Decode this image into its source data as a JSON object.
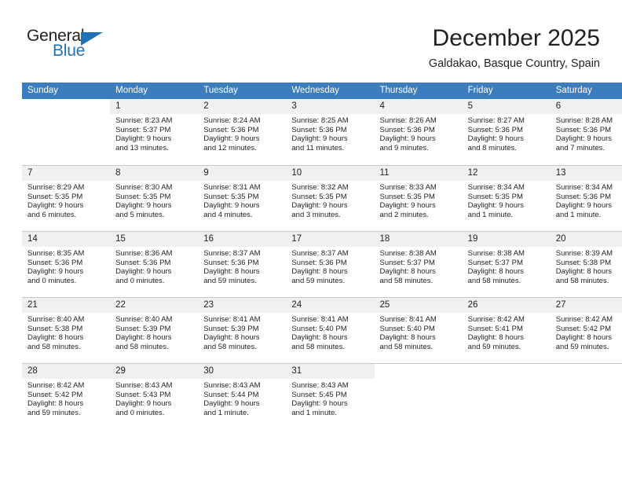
{
  "brand": {
    "name_part1": "General",
    "name_part2": "Blue",
    "triangle_color": "#1f72b8"
  },
  "header": {
    "title": "December 2025",
    "location": "Galdakao, Basque Country, Spain"
  },
  "theme": {
    "header_row_bg": "#3b7dbd",
    "header_row_text": "#ffffff",
    "daynum_bg": "#f0f0f0",
    "grid_line": "#c8c8c8",
    "text": "#231f20"
  },
  "weekdays": [
    "Sunday",
    "Monday",
    "Tuesday",
    "Wednesday",
    "Thursday",
    "Friday",
    "Saturday"
  ],
  "weeks": [
    [
      {
        "day": "",
        "sunrise": "",
        "sunset": "",
        "daylight_line1": "",
        "daylight_line2": ""
      },
      {
        "day": "1",
        "sunrise": "Sunrise: 8:23 AM",
        "sunset": "Sunset: 5:37 PM",
        "daylight_line1": "Daylight: 9 hours",
        "daylight_line2": "and 13 minutes."
      },
      {
        "day": "2",
        "sunrise": "Sunrise: 8:24 AM",
        "sunset": "Sunset: 5:36 PM",
        "daylight_line1": "Daylight: 9 hours",
        "daylight_line2": "and 12 minutes."
      },
      {
        "day": "3",
        "sunrise": "Sunrise: 8:25 AM",
        "sunset": "Sunset: 5:36 PM",
        "daylight_line1": "Daylight: 9 hours",
        "daylight_line2": "and 11 minutes."
      },
      {
        "day": "4",
        "sunrise": "Sunrise: 8:26 AM",
        "sunset": "Sunset: 5:36 PM",
        "daylight_line1": "Daylight: 9 hours",
        "daylight_line2": "and 9 minutes."
      },
      {
        "day": "5",
        "sunrise": "Sunrise: 8:27 AM",
        "sunset": "Sunset: 5:36 PM",
        "daylight_line1": "Daylight: 9 hours",
        "daylight_line2": "and 8 minutes."
      },
      {
        "day": "6",
        "sunrise": "Sunrise: 8:28 AM",
        "sunset": "Sunset: 5:36 PM",
        "daylight_line1": "Daylight: 9 hours",
        "daylight_line2": "and 7 minutes."
      }
    ],
    [
      {
        "day": "7",
        "sunrise": "Sunrise: 8:29 AM",
        "sunset": "Sunset: 5:35 PM",
        "daylight_line1": "Daylight: 9 hours",
        "daylight_line2": "and 6 minutes."
      },
      {
        "day": "8",
        "sunrise": "Sunrise: 8:30 AM",
        "sunset": "Sunset: 5:35 PM",
        "daylight_line1": "Daylight: 9 hours",
        "daylight_line2": "and 5 minutes."
      },
      {
        "day": "9",
        "sunrise": "Sunrise: 8:31 AM",
        "sunset": "Sunset: 5:35 PM",
        "daylight_line1": "Daylight: 9 hours",
        "daylight_line2": "and 4 minutes."
      },
      {
        "day": "10",
        "sunrise": "Sunrise: 8:32 AM",
        "sunset": "Sunset: 5:35 PM",
        "daylight_line1": "Daylight: 9 hours",
        "daylight_line2": "and 3 minutes."
      },
      {
        "day": "11",
        "sunrise": "Sunrise: 8:33 AM",
        "sunset": "Sunset: 5:35 PM",
        "daylight_line1": "Daylight: 9 hours",
        "daylight_line2": "and 2 minutes."
      },
      {
        "day": "12",
        "sunrise": "Sunrise: 8:34 AM",
        "sunset": "Sunset: 5:35 PM",
        "daylight_line1": "Daylight: 9 hours",
        "daylight_line2": "and 1 minute."
      },
      {
        "day": "13",
        "sunrise": "Sunrise: 8:34 AM",
        "sunset": "Sunset: 5:36 PM",
        "daylight_line1": "Daylight: 9 hours",
        "daylight_line2": "and 1 minute."
      }
    ],
    [
      {
        "day": "14",
        "sunrise": "Sunrise: 8:35 AM",
        "sunset": "Sunset: 5:36 PM",
        "daylight_line1": "Daylight: 9 hours",
        "daylight_line2": "and 0 minutes."
      },
      {
        "day": "15",
        "sunrise": "Sunrise: 8:36 AM",
        "sunset": "Sunset: 5:36 PM",
        "daylight_line1": "Daylight: 9 hours",
        "daylight_line2": "and 0 minutes."
      },
      {
        "day": "16",
        "sunrise": "Sunrise: 8:37 AM",
        "sunset": "Sunset: 5:36 PM",
        "daylight_line1": "Daylight: 8 hours",
        "daylight_line2": "and 59 minutes."
      },
      {
        "day": "17",
        "sunrise": "Sunrise: 8:37 AM",
        "sunset": "Sunset: 5:36 PM",
        "daylight_line1": "Daylight: 8 hours",
        "daylight_line2": "and 59 minutes."
      },
      {
        "day": "18",
        "sunrise": "Sunrise: 8:38 AM",
        "sunset": "Sunset: 5:37 PM",
        "daylight_line1": "Daylight: 8 hours",
        "daylight_line2": "and 58 minutes."
      },
      {
        "day": "19",
        "sunrise": "Sunrise: 8:38 AM",
        "sunset": "Sunset: 5:37 PM",
        "daylight_line1": "Daylight: 8 hours",
        "daylight_line2": "and 58 minutes."
      },
      {
        "day": "20",
        "sunrise": "Sunrise: 8:39 AM",
        "sunset": "Sunset: 5:38 PM",
        "daylight_line1": "Daylight: 8 hours",
        "daylight_line2": "and 58 minutes."
      }
    ],
    [
      {
        "day": "21",
        "sunrise": "Sunrise: 8:40 AM",
        "sunset": "Sunset: 5:38 PM",
        "daylight_line1": "Daylight: 8 hours",
        "daylight_line2": "and 58 minutes."
      },
      {
        "day": "22",
        "sunrise": "Sunrise: 8:40 AM",
        "sunset": "Sunset: 5:39 PM",
        "daylight_line1": "Daylight: 8 hours",
        "daylight_line2": "and 58 minutes."
      },
      {
        "day": "23",
        "sunrise": "Sunrise: 8:41 AM",
        "sunset": "Sunset: 5:39 PM",
        "daylight_line1": "Daylight: 8 hours",
        "daylight_line2": "and 58 minutes."
      },
      {
        "day": "24",
        "sunrise": "Sunrise: 8:41 AM",
        "sunset": "Sunset: 5:40 PM",
        "daylight_line1": "Daylight: 8 hours",
        "daylight_line2": "and 58 minutes."
      },
      {
        "day": "25",
        "sunrise": "Sunrise: 8:41 AM",
        "sunset": "Sunset: 5:40 PM",
        "daylight_line1": "Daylight: 8 hours",
        "daylight_line2": "and 58 minutes."
      },
      {
        "day": "26",
        "sunrise": "Sunrise: 8:42 AM",
        "sunset": "Sunset: 5:41 PM",
        "daylight_line1": "Daylight: 8 hours",
        "daylight_line2": "and 59 minutes."
      },
      {
        "day": "27",
        "sunrise": "Sunrise: 8:42 AM",
        "sunset": "Sunset: 5:42 PM",
        "daylight_line1": "Daylight: 8 hours",
        "daylight_line2": "and 59 minutes."
      }
    ],
    [
      {
        "day": "28",
        "sunrise": "Sunrise: 8:42 AM",
        "sunset": "Sunset: 5:42 PM",
        "daylight_line1": "Daylight: 8 hours",
        "daylight_line2": "and 59 minutes."
      },
      {
        "day": "29",
        "sunrise": "Sunrise: 8:43 AM",
        "sunset": "Sunset: 5:43 PM",
        "daylight_line1": "Daylight: 9 hours",
        "daylight_line2": "and 0 minutes."
      },
      {
        "day": "30",
        "sunrise": "Sunrise: 8:43 AM",
        "sunset": "Sunset: 5:44 PM",
        "daylight_line1": "Daylight: 9 hours",
        "daylight_line2": "and 1 minute."
      },
      {
        "day": "31",
        "sunrise": "Sunrise: 8:43 AM",
        "sunset": "Sunset: 5:45 PM",
        "daylight_line1": "Daylight: 9 hours",
        "daylight_line2": "and 1 minute."
      },
      {
        "day": "",
        "sunrise": "",
        "sunset": "",
        "daylight_line1": "",
        "daylight_line2": ""
      },
      {
        "day": "",
        "sunrise": "",
        "sunset": "",
        "daylight_line1": "",
        "daylight_line2": ""
      },
      {
        "day": "",
        "sunrise": "",
        "sunset": "",
        "daylight_line1": "",
        "daylight_line2": ""
      }
    ]
  ]
}
